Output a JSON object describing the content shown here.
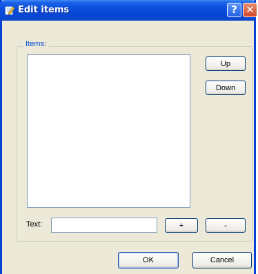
{
  "window": {
    "title": "Edit items",
    "help_glyph": "?",
    "close_glyph": "✕"
  },
  "items_group": {
    "label": "Items:",
    "items": []
  },
  "buttons": {
    "up": "Up",
    "down": "Down",
    "add": "+",
    "remove": "-",
    "ok": "OK",
    "cancel": "Cancel"
  },
  "text_field": {
    "label": "Text:",
    "value": ""
  },
  "icons": {
    "title": "edit-pencil-icon",
    "help": "help-icon",
    "close": "close-icon"
  },
  "colors": {
    "titlebar": "#0a4fdc",
    "close_button": "#d24a2a",
    "group_label": "#0046d5",
    "dialog_bg": "#ece9d8"
  }
}
